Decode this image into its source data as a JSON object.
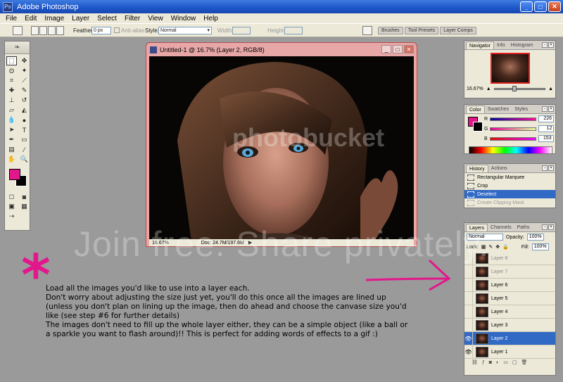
{
  "app": {
    "title": "Adobe Photoshop",
    "logo_text": "Ps"
  },
  "menu": [
    "File",
    "Edit",
    "Image",
    "Layer",
    "Select",
    "Filter",
    "View",
    "Window",
    "Help"
  ],
  "options": {
    "feather_label": "Feather:",
    "feather_value": "0 px",
    "antialias_label": "Anti-alias",
    "style_label": "Style:",
    "style_value": "Normal",
    "width_label": "Width:",
    "height_label": "Height:",
    "palette_tabs": [
      "Brushes",
      "Tool Presets",
      "Layer Comps"
    ]
  },
  "document": {
    "title": "Untitled-1 @ 16.7% (Layer 2, RGB/8)",
    "zoom": "16.67%",
    "doc_size": "Doc: 24.7M/197.6M"
  },
  "navigator": {
    "tabs": [
      "Navigator",
      "Info",
      "Histogram"
    ],
    "zoom": "16.67%",
    "zoom_slider_fraction": 0.35
  },
  "color": {
    "tabs": [
      "Color",
      "Swatches",
      "Styles"
    ],
    "foreground": "#e2178c",
    "background": "#000000",
    "channels": [
      {
        "label": "R",
        "value": "226"
      },
      {
        "label": "G",
        "value": "12"
      },
      {
        "label": "B",
        "value": "153"
      }
    ]
  },
  "history": {
    "tabs": [
      "History",
      "Actions"
    ],
    "items": [
      {
        "label": "Rectangular Marquee",
        "state": "normal"
      },
      {
        "label": "Crop",
        "state": "normal"
      },
      {
        "label": "Deselect",
        "state": "active"
      },
      {
        "label": "Create Clipping Mask",
        "state": "dim"
      }
    ]
  },
  "layers": {
    "tabs": [
      "Layers",
      "Channels",
      "Paths"
    ],
    "blend_mode": "Normal",
    "opacity_label": "Opacity:",
    "opacity": "100%",
    "lock_label": "Lock:",
    "fill_label": "Fill:",
    "fill": "100%",
    "items": [
      {
        "name": "Layer 8",
        "visible": false,
        "state": "dim"
      },
      {
        "name": "Layer 7",
        "visible": false,
        "state": "dim"
      },
      {
        "name": "Layer 6",
        "visible": false,
        "state": "normal"
      },
      {
        "name": "Layer 5",
        "visible": false,
        "state": "normal"
      },
      {
        "name": "Layer 4",
        "visible": false,
        "state": "normal"
      },
      {
        "name": "Layer 3",
        "visible": false,
        "state": "normal"
      },
      {
        "name": "Layer 2",
        "visible": true,
        "state": "active"
      },
      {
        "name": "Layer 1",
        "visible": true,
        "state": "normal"
      }
    ]
  },
  "annotation": {
    "asterisk": "*",
    "accent_color": "#e2178c",
    "lines": [
      "Load all the images you'd like to use into a layer each.",
      "Don't worry about adjusting the size just yet, you'll do this once all the images are lined up",
      "(unless you don't plan on lining up the image, then do ahead and choose the canvase size you'd",
      "like (see step #6 for further details)",
      "The images don't need to fill up the whole layer either, they can be a simple object (like a ball or",
      "a sparkle you want to flash around)!!  This is perfect for adding words of effects to a gif :)"
    ]
  },
  "watermark": {
    "top": "photobucket",
    "bottom": "Join free. Share privately."
  }
}
